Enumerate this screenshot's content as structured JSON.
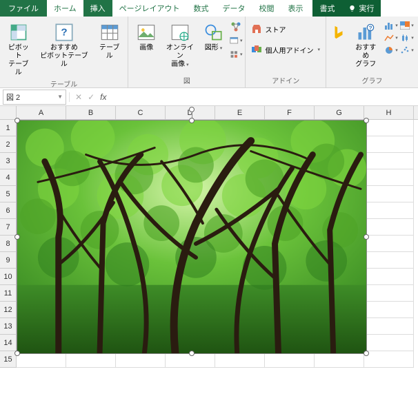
{
  "tabs": {
    "file": "ファイル",
    "home": "ホーム",
    "insert": "挿入",
    "pagelayout": "ページレイアウト",
    "formulas": "数式",
    "data": "データ",
    "review": "校閲",
    "view": "表示",
    "format": "書式",
    "tellme": "実行"
  },
  "ribbon": {
    "tables": {
      "pivot": "ピボット\nテーブル",
      "recpivot": "おすすめ\nピボットテーブル",
      "table": "テーブル",
      "label": "テーブル"
    },
    "illust": {
      "picture": "画像",
      "online": "オンライン\n画像",
      "shapes": "図形",
      "label": "図"
    },
    "addins": {
      "store": "ストア",
      "myaddins": "個人用アドイン",
      "label": "アドイン"
    },
    "charts": {
      "rec": "おすすめ\nグラフ",
      "label": "グラフ"
    }
  },
  "namebox": "図 2",
  "fxlabel": "fx",
  "columns": [
    "A",
    "B",
    "C",
    "D",
    "E",
    "F",
    "G",
    "H"
  ],
  "rows": [
    "1",
    "2",
    "3",
    "4",
    "5",
    "6",
    "7",
    "8",
    "9",
    "10",
    "11",
    "12",
    "13",
    "14",
    "15"
  ],
  "image": {
    "alt": "forest-photo"
  }
}
